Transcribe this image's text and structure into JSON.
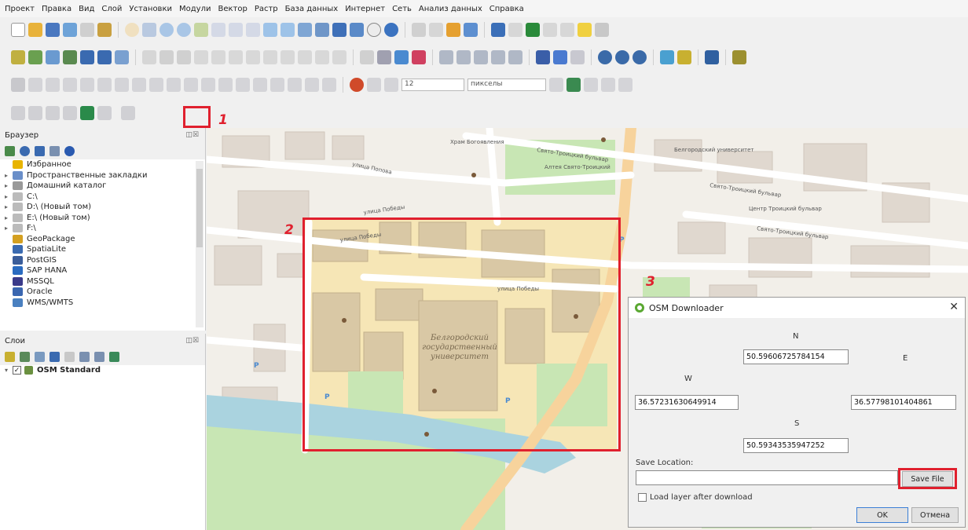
{
  "menu": [
    "Проект",
    "Правка",
    "Вид",
    "Слой",
    "Установки",
    "Модули",
    "Вектор",
    "Растр",
    "База данных",
    "Интернет",
    "Сеть",
    "Анализ данных",
    "Справка"
  ],
  "toolbar": {
    "font_size_value": "12",
    "font_units": "пикселы"
  },
  "browser": {
    "title": "Браузер",
    "items": [
      {
        "label": "Избранное",
        "icon": "star-icon",
        "color": "#e8b400"
      },
      {
        "label": "Пространственные закладки",
        "icon": "bookmark-icon",
        "color": "#6a8fc9"
      },
      {
        "label": "Домашний каталог",
        "icon": "home-folder-icon",
        "color": "#999999"
      },
      {
        "label": "C:\\",
        "icon": "drive-icon",
        "color": "#bbbbbb"
      },
      {
        "label": "D:\\ (Новый том)",
        "icon": "drive-icon",
        "color": "#bbbbbb"
      },
      {
        "label": "E:\\ (Новый том)",
        "icon": "drive-icon",
        "color": "#bbbbbb"
      },
      {
        "label": "F:\\",
        "icon": "drive-icon",
        "color": "#bbbbbb"
      },
      {
        "label": "GeoPackage",
        "icon": "geopackage-icon",
        "color": "#d4a020"
      },
      {
        "label": "SpatiaLite",
        "icon": "spatialite-icon",
        "color": "#3a6ab0"
      },
      {
        "label": "PostGIS",
        "icon": "postgis-icon",
        "color": "#3a5d9a"
      },
      {
        "label": "SAP HANA",
        "icon": "sap-hana-icon",
        "color": "#2a6bc0"
      },
      {
        "label": "MSSQL",
        "icon": "mssql-icon",
        "color": "#3a3a8a"
      },
      {
        "label": "Oracle",
        "icon": "oracle-icon",
        "color": "#3a66b0"
      },
      {
        "label": "WMS/WMTS",
        "icon": "wms-icon",
        "color": "#4a80c0"
      }
    ]
  },
  "layers": {
    "title": "Слои",
    "items": [
      {
        "label": "OSM Standard",
        "checked": true
      }
    ]
  },
  "annotations": {
    "marker1": "1",
    "marker2": "2",
    "marker3": "3"
  },
  "map": {
    "streets": [
      "Свято-Троицкий бульвар",
      "Свято-Троицкий бульвар",
      "Свято-Троицкий бульвар",
      "улица Победы",
      "улица Победы",
      "улица Победы",
      "улица Попова"
    ],
    "labels": [
      "Белгородский",
      "государственный",
      "университет",
      "Алтея Свято-Троицкий",
      "Храм Богоявления",
      "Белгородский университет",
      "Центр Троицкий бульвар"
    ]
  },
  "dialog": {
    "title": "OSM Downloader",
    "n_label": "N",
    "n_value": "50.59606725784154",
    "w_label": "W",
    "w_value": "36.57231630649914",
    "e_label": "E",
    "e_value": "36.57798101404861",
    "s_label": "S",
    "s_value": "50.59343535947252",
    "save_location_label": "Save Location:",
    "save_location_value": "",
    "save_file_label": "Save File",
    "load_layer_label": "Load layer after download",
    "ok_label": "OK",
    "cancel_label": "Отмена"
  }
}
